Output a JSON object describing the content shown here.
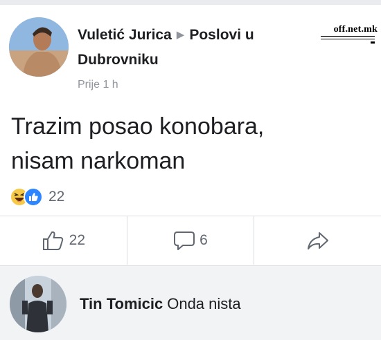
{
  "post": {
    "author": "Vuletić Jurica",
    "group_line1": "Poslovi u",
    "group_line2": "Dubrovniku",
    "timestamp": "Prije 1 h",
    "text_line1": "Trazim posao konobara,",
    "text_line2": "nisam narkoman",
    "avatar_icon": "person-photo",
    "separator_icon": "triangle-right-icon"
  },
  "watermark": {
    "text": "off.net.mk"
  },
  "reactions": {
    "icons": [
      "haha-emoji-icon",
      "like-reaction-icon"
    ],
    "count": "22"
  },
  "actions": {
    "like_count": "22",
    "comment_count": "6",
    "icons": [
      "thumbs-up-icon",
      "comment-bubble-icon",
      "share-arrow-icon"
    ]
  },
  "comment": {
    "author": "Tin Tomicic",
    "text": "Onda nista",
    "avatar_icon": "person-photo"
  },
  "colors": {
    "text_primary": "#1c1e21",
    "text_secondary": "#90949c",
    "like_blue": "#2d86ff",
    "haha_yellow": "#f7c948",
    "comment_background": "#f2f3f5"
  }
}
